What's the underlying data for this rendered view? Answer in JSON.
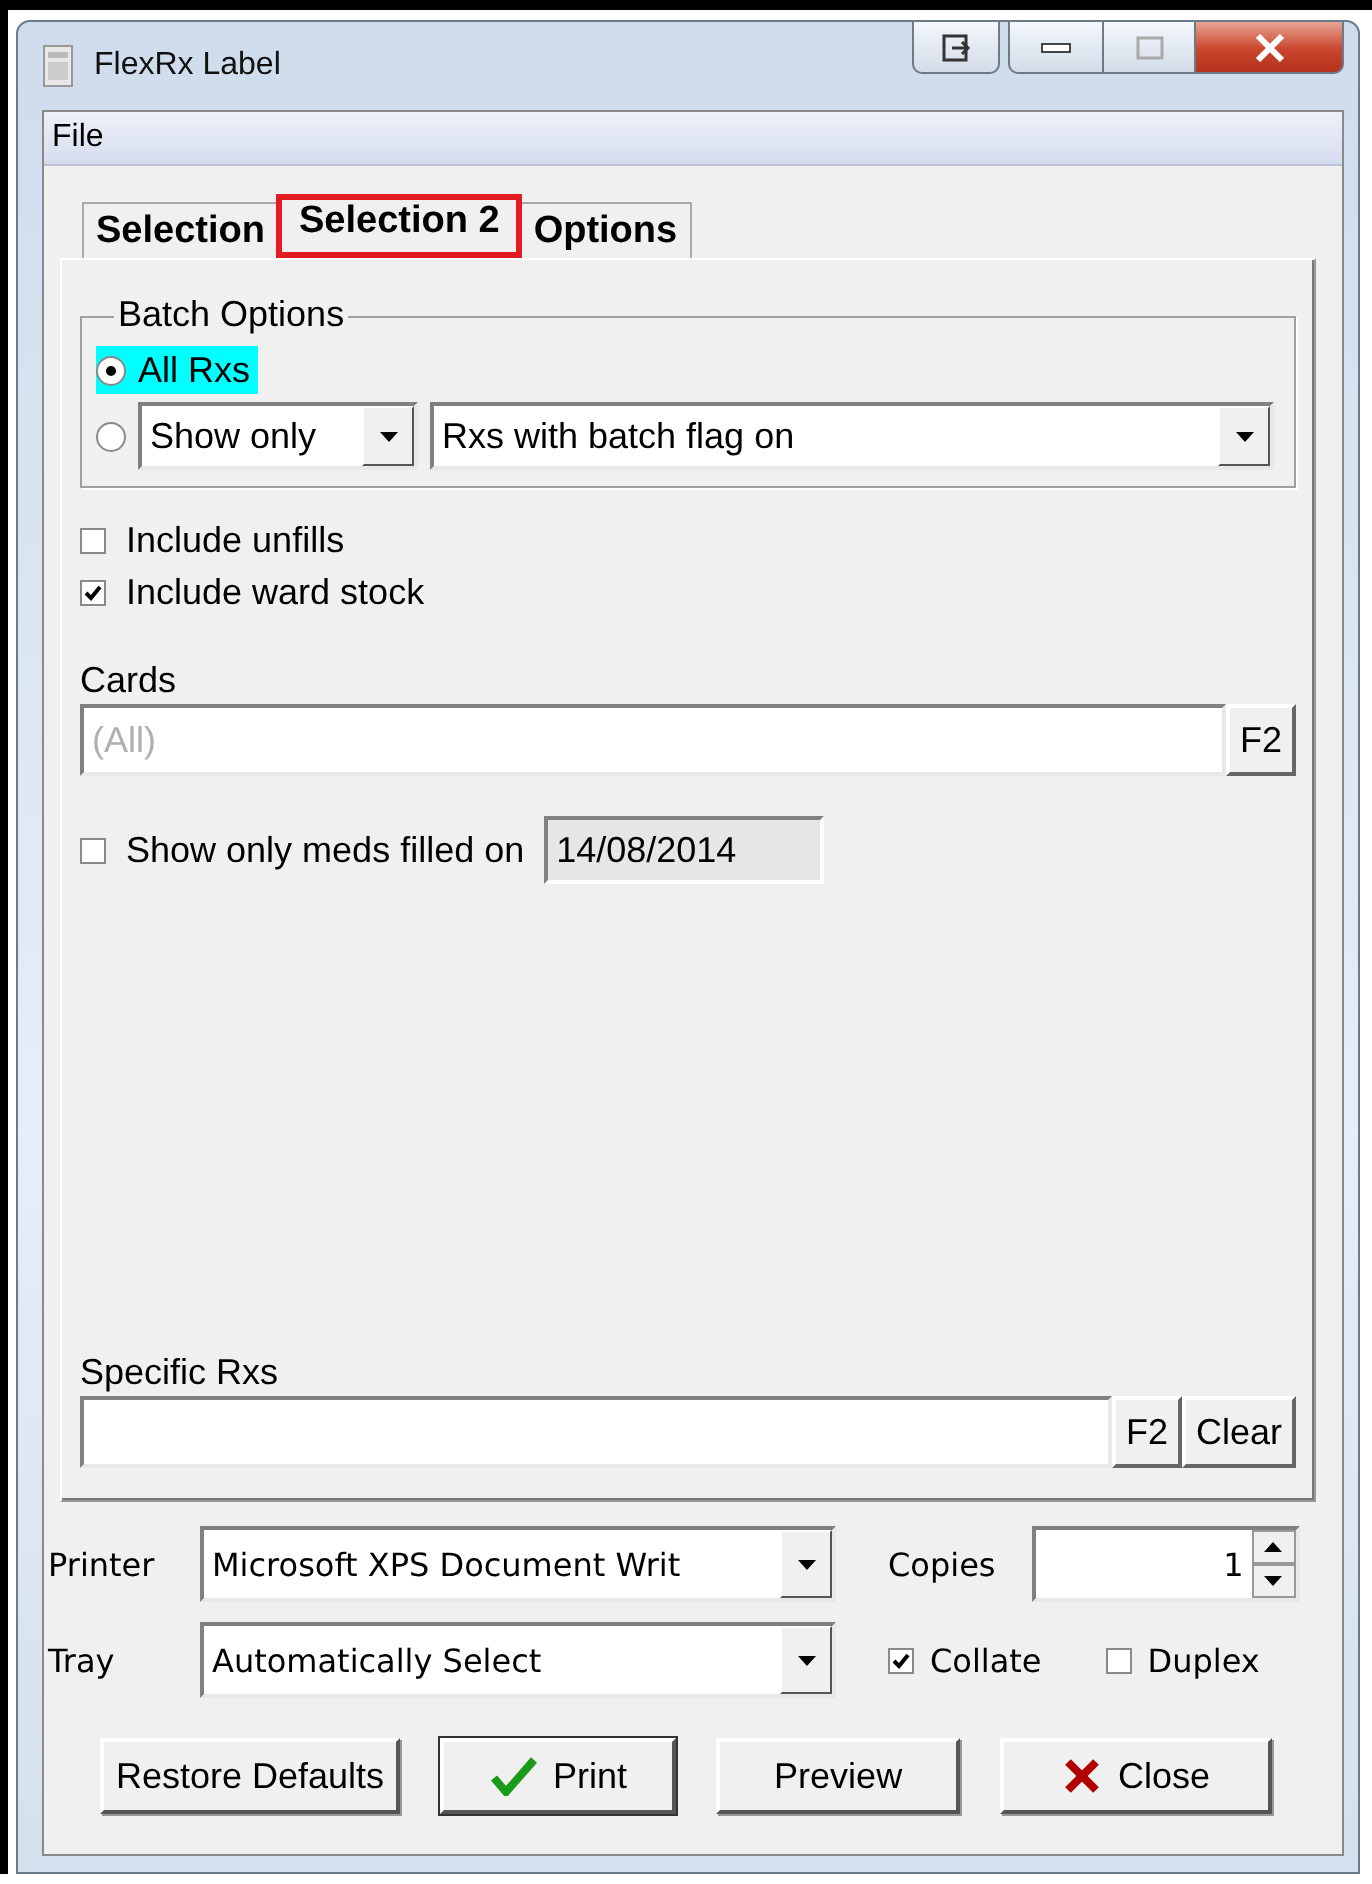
{
  "window": {
    "title": "FlexRx Label"
  },
  "menu": [
    {
      "label": "File"
    }
  ],
  "tabs": [
    {
      "label": "Selection",
      "selected": false
    },
    {
      "label": "Selection 2",
      "selected": true
    },
    {
      "label": "Options",
      "selected": false
    }
  ],
  "batch_options": {
    "title": "Batch Options",
    "options": [
      {
        "kind": "radio",
        "label": "All Rxs",
        "selected": true,
        "highlighted": true
      },
      {
        "kind": "combo",
        "selected": false,
        "filter": "Show only",
        "criterion": "Rxs with batch flag on"
      }
    ]
  },
  "checkboxes": [
    {
      "label": "Include unfills",
      "checked": false
    },
    {
      "label": "Include ward stock",
      "checked": true
    }
  ],
  "cards": {
    "label": "Cards",
    "placeholder": "(All)",
    "button": "F2"
  },
  "filled_on": {
    "label": "Show only meds filled on",
    "checked": false,
    "date": "14/08/2014"
  },
  "specific_rxs": {
    "label": "Specific Rxs",
    "buttons": [
      "F2",
      "Clear"
    ]
  },
  "printer": {
    "label": "Printer",
    "value": "Microsoft XPS Document Writ"
  },
  "tray": {
    "label": "Tray",
    "value": "Automatically Select"
  },
  "copies": {
    "label": "Copies",
    "value": "1"
  },
  "collate": {
    "label": "Collate",
    "checked": true
  },
  "duplex": {
    "label": "Duplex",
    "checked": false
  },
  "buttons": [
    {
      "kind": "plain",
      "label": "Restore Defaults",
      "default": false
    },
    {
      "kind": "print",
      "label": "Print",
      "default": true
    },
    {
      "kind": "plain",
      "label": "Preview",
      "default": false
    },
    {
      "kind": "close",
      "label": "Close",
      "default": false
    }
  ]
}
